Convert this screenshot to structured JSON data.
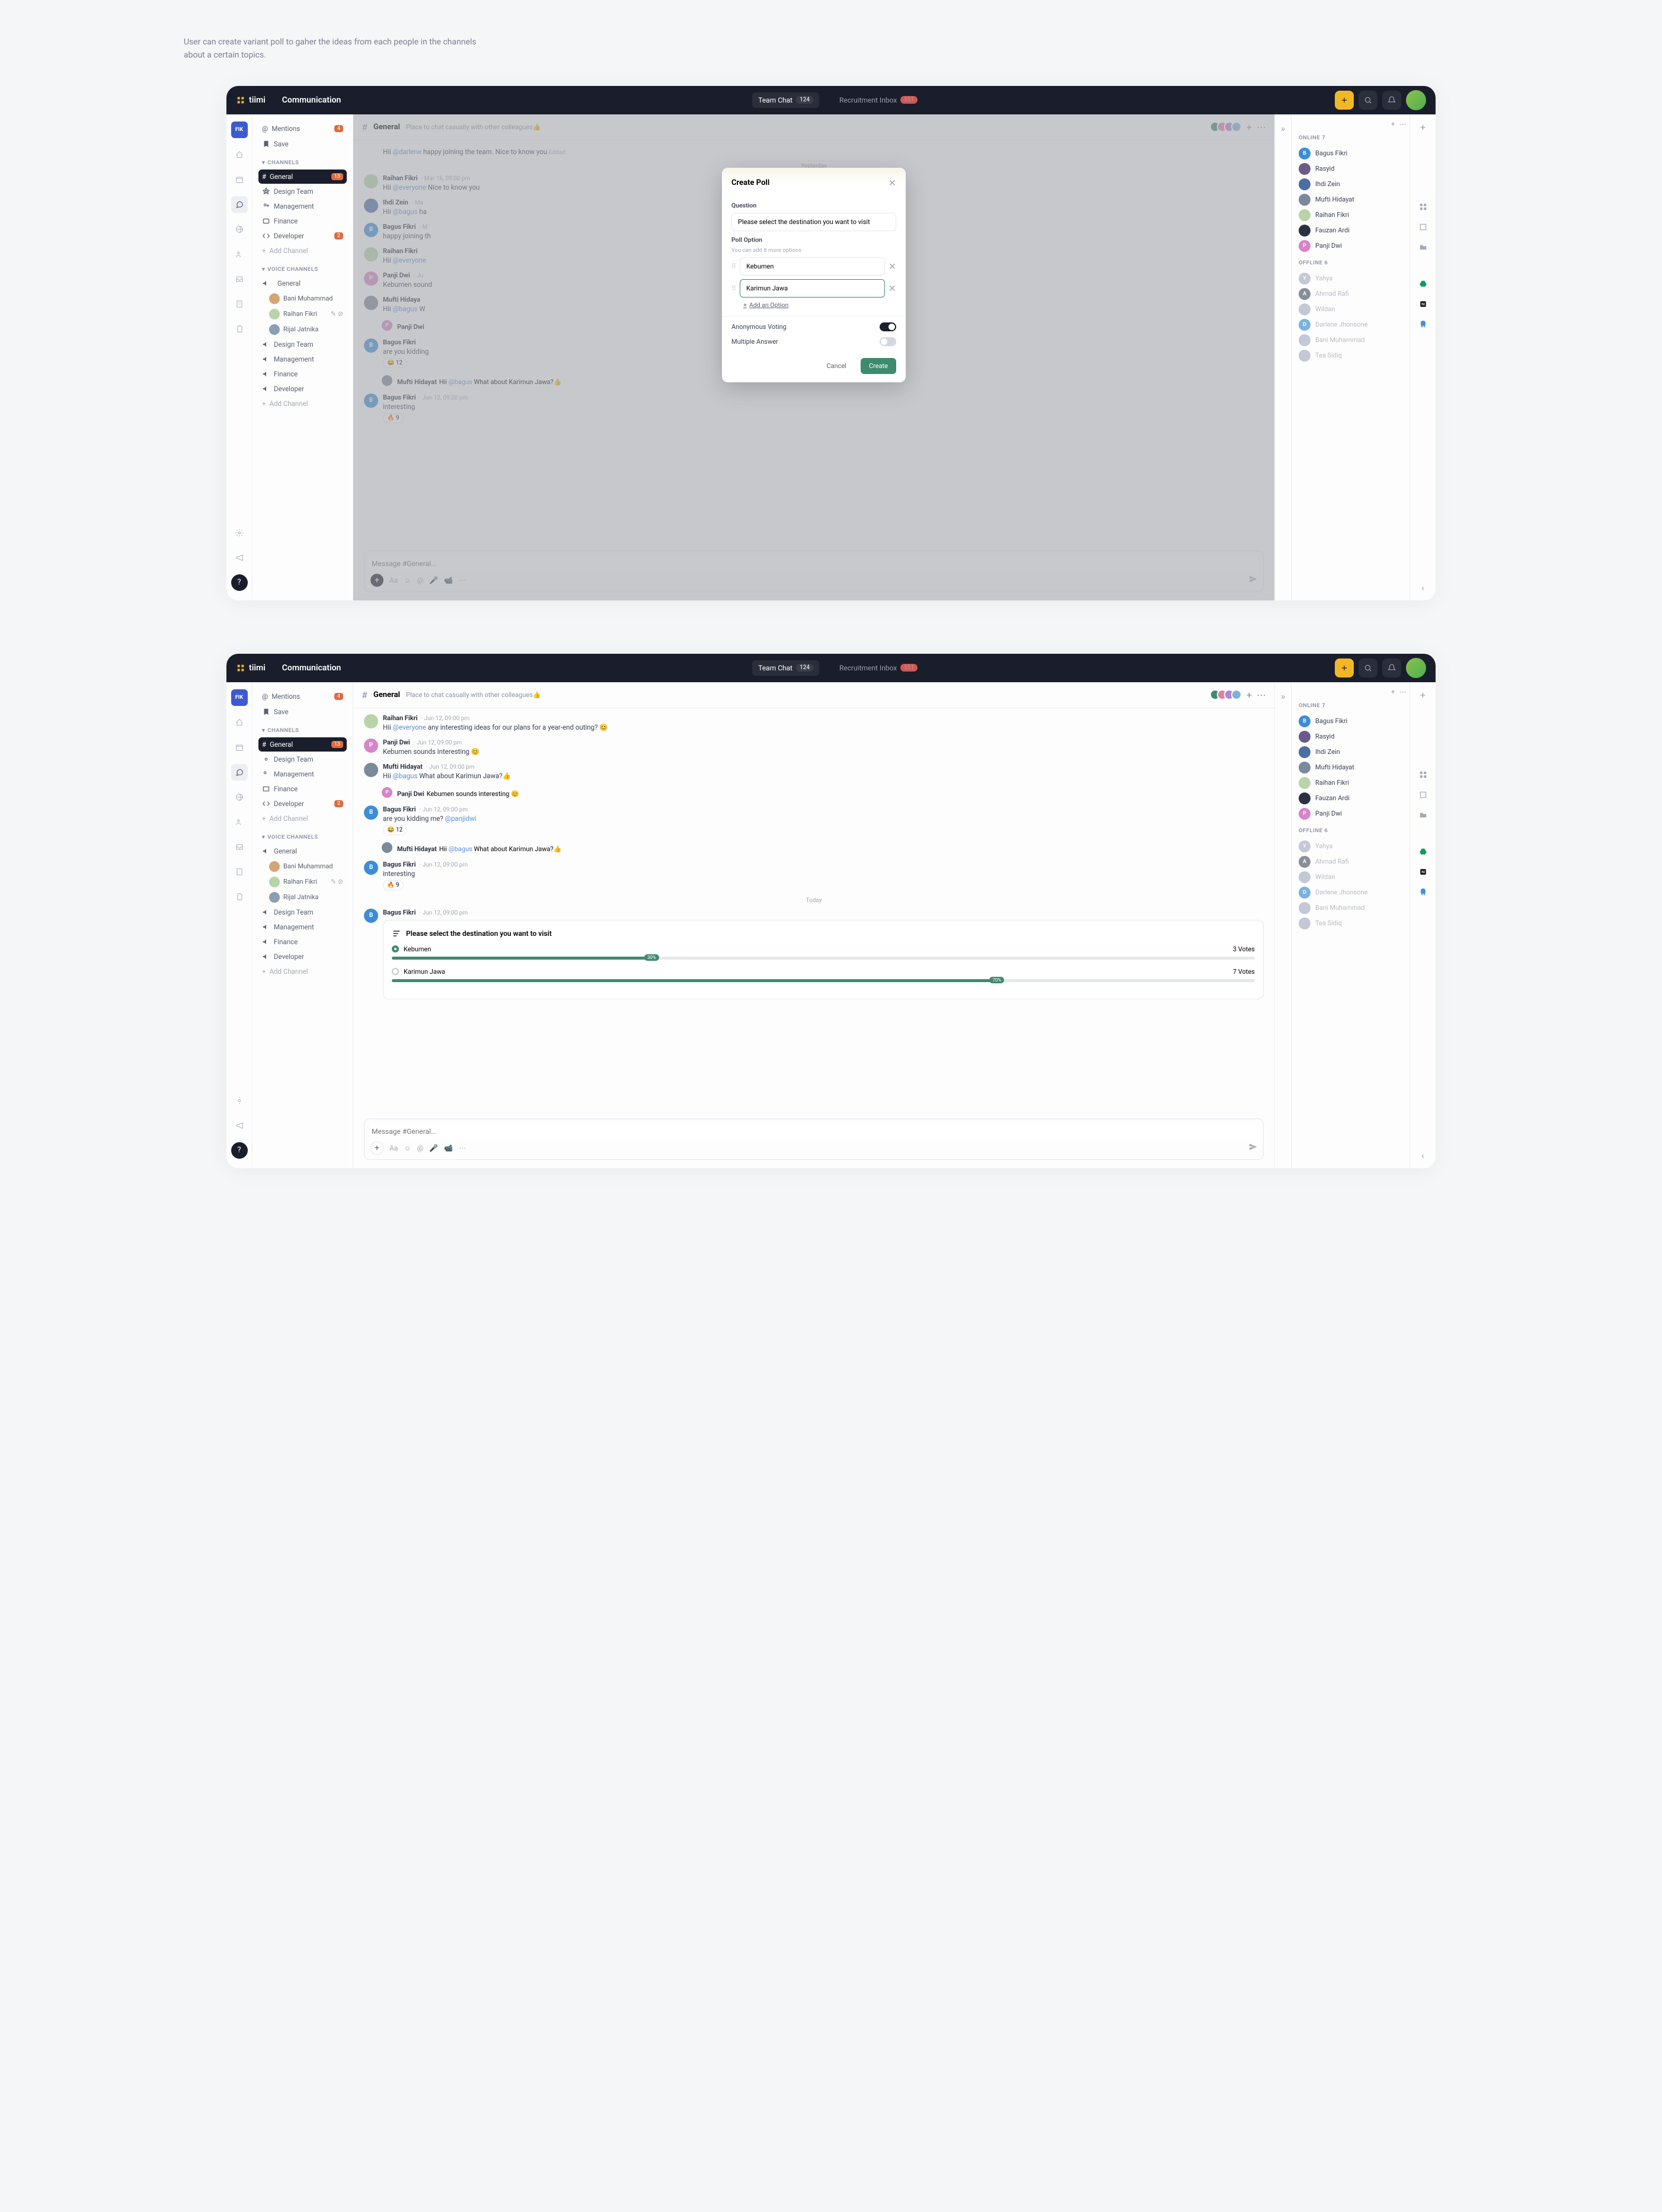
{
  "caption": "User can create variant poll to gaher the ideas from each people in the channels about a certain topics.",
  "app": {
    "name": "tiimi",
    "section": "Communication"
  },
  "header": {
    "tabs": [
      {
        "label": "Team Chat",
        "count": "124",
        "active": true
      },
      {
        "label": "Recruitment Inbox",
        "count": "551",
        "active": false
      }
    ]
  },
  "sidebar": {
    "mentions": "Mentions",
    "mentions_badge": "4",
    "save": "Save",
    "channels_label": "CHANNELS",
    "channels": [
      {
        "name": "General",
        "badge": "13",
        "active": true
      },
      {
        "name": "Design Team"
      },
      {
        "name": "Management"
      },
      {
        "name": "Finance"
      },
      {
        "name": "Developer",
        "badge": "2"
      }
    ],
    "add_channel": "Add Channel",
    "voice_label": "VOICE CHANNELS",
    "voice_channel": "General",
    "voice_members": [
      "Bani Muhammad",
      "Raihan Fikri",
      "Rijal Jatnika"
    ],
    "voice_channels2": [
      "Design Team",
      "Management",
      "Finance",
      "Developer"
    ]
  },
  "channel": {
    "name": "General",
    "desc": "Place to chat casually with other colleagues",
    "sep_yesterday": "Yesterday",
    "sep_today": "Today",
    "messages_a": [
      {
        "partial": true,
        "text_pre": "Hii ",
        "mention": "@darlene",
        "text_post": " happy joining the team. Nice to know you ",
        "edited": "Edited"
      },
      {
        "name": "Raihan Fikri",
        "ts": "Mar 16, 09:00 pm",
        "text_pre": "Hii ",
        "mention": "@everyone",
        "text_post": " Nice to know you",
        "av": "#b8d4a8"
      },
      {
        "name": "Ihdi Zein",
        "ts": "Ma",
        "text_pre": "Hii ",
        "mention": "@bagus",
        "text_post": " ha",
        "av": "#4a6fa5"
      },
      {
        "name": "Bagus Fikri",
        "ts": "M",
        "text_pre": "happy joining th",
        "av": "#3d8dd6",
        "initial": "B"
      },
      {
        "name": "Raihan Fikri",
        "ts": "",
        "text_pre": "Hii ",
        "mention": "@everyone",
        "av": "#b8d4a8"
      },
      {
        "name": "Panji Dwi",
        "ts": "Ju",
        "text_pre": "Kebumen sound",
        "av": "#d686c8",
        "initial": "P"
      },
      {
        "name": "Mufti Hidaya",
        "ts": "",
        "text_pre": "Hii ",
        "mention": "@bagus",
        "text_post": " W",
        "av": "#7a8a9a"
      },
      {
        "thread": true,
        "sm": true,
        "name": "Panji Dwi",
        "text_pre": "",
        "av": "#d686c8",
        "initial": "P"
      },
      {
        "name": "Bagus Fikri",
        "ts": "",
        "text_pre": "are you kidding",
        "react": "😂 12",
        "av": "#3d8dd6",
        "initial": "B"
      },
      {
        "thread": true,
        "sm": true,
        "name": "Mufti Hidayat",
        "text_pre": "Hii ",
        "mention": "@bagus",
        "text_post": " What about Karimun Jawa?👍",
        "av": "#7a8a9a"
      },
      {
        "name": "Bagus Fikri",
        "ts": "Jun 12, 09:00 pm",
        "text_pre": "interesting",
        "react": "🔥 9",
        "av": "#3d8dd6",
        "initial": "B"
      }
    ],
    "messages_b": [
      {
        "name": "Raihan Fikri",
        "ts": "Jun 12, 09:00 pm",
        "text_pre": "Hii ",
        "mention": "@everyone",
        "text_post": " any interesting ideas for our plans for a year-end outing? 😊",
        "av": "#b8d4a8"
      },
      {
        "name": "Panji Dwi",
        "ts": "Jun 12, 09:00 pm",
        "text_pre": "Kebumen sounds interesting 😊",
        "av": "#d686c8",
        "initial": "P"
      },
      {
        "name": "Mufti Hidayat",
        "ts": "Jun 12, 09:00 pm",
        "text_pre": "Hii ",
        "mention": "@bagus",
        "text_post": " What about Karimun Jawa?👍",
        "av": "#7a8a9a"
      },
      {
        "thread": true,
        "sm": true,
        "name": "Panji Dwi",
        "text_pre": "Kebumen sounds interesting 😊",
        "av": "#d686c8",
        "initial": "P"
      },
      {
        "name": "Bagus Fikri",
        "ts": "Jun 12, 09:00 pm",
        "text_pre": "are you kidding me? ",
        "mention": "@panjidwi",
        "react": "😂 12",
        "av": "#3d8dd6",
        "initial": "B"
      },
      {
        "thread": true,
        "sm": true,
        "name": "Mufti Hidayat",
        "text_pre": "Hii ",
        "mention": "@bagus",
        "text_post": " What about Karimun Jawa?👍",
        "av": "#7a8a9a"
      },
      {
        "name": "Bagus Fikri",
        "ts": "Jun 12, 09:00 pm",
        "text_pre": "interesting",
        "react": "🔥 9",
        "av": "#3d8dd6",
        "initial": "B"
      }
    ],
    "poll_msg": {
      "name": "Bagus Fikri",
      "ts": "Jun 12, 09:00 pm",
      "av": "#3d8dd6",
      "initial": "B"
    },
    "composer_placeholder": "Message #General..."
  },
  "members": {
    "online_label": "ONLINE",
    "online_count": "7",
    "online": [
      {
        "name": "Bagus Fikri",
        "i": "B",
        "c": "#3d8dd6"
      },
      {
        "name": "Rasyid",
        "i": "",
        "c": "#6a5b8a"
      },
      {
        "name": "Ihdi Zein",
        "i": "",
        "c": "#4a6fa5"
      },
      {
        "name": "Mufti Hidayat",
        "i": "",
        "c": "#7a8a9a"
      },
      {
        "name": "Raihan Fikri",
        "i": "",
        "c": "#b8d4a8"
      },
      {
        "name": "Fauzan Ardi",
        "i": "",
        "c": "#2c3142"
      },
      {
        "name": "Panji Dwi",
        "i": "P",
        "c": "#d686c8"
      }
    ],
    "offline_label": "OFFLINE",
    "offline_count": "6",
    "offline": [
      {
        "name": "Yahya",
        "i": "Y",
        "c": "#c4c8d4"
      },
      {
        "name": "Ahmad Rafi",
        "i": "A",
        "c": "#8a8e9a"
      },
      {
        "name": "Wildan",
        "i": "",
        "c": "#c4c8d4"
      },
      {
        "name": "Darlene Jhonsone",
        "i": "D",
        "c": "#7ab3e0"
      },
      {
        "name": "Bani Muhammad",
        "i": "",
        "c": "#c4c8d4"
      },
      {
        "name": "Tea Sidiq",
        "i": "",
        "c": "#c4c8d4"
      }
    ]
  },
  "modal": {
    "title": "Create Poll",
    "question_label": "Question",
    "question_value": "Please select the destination you want to visit",
    "option_label": "Poll Option",
    "option_hint": "You can add 8 more options",
    "options": [
      "Kebumen",
      "Karimun Jawa"
    ],
    "add_option": "Add an Option",
    "anon": "Anonymous Voting",
    "multi": "Multiple Answer",
    "cancel": "Cancel",
    "create": "Create"
  },
  "chart_data": {
    "type": "bar",
    "title": "Please select the destination you want to visit",
    "categories": [
      "Kebumen",
      "Karimun Jawa"
    ],
    "series": [
      {
        "name": "Votes",
        "values": [
          3,
          7
        ]
      },
      {
        "name": "Percent",
        "values": [
          30,
          70
        ]
      }
    ],
    "value_labels": [
      "3 Votes",
      "7 Votes"
    ],
    "pct_labels": [
      "30%",
      "70%"
    ],
    "selected": "Kebumen"
  }
}
